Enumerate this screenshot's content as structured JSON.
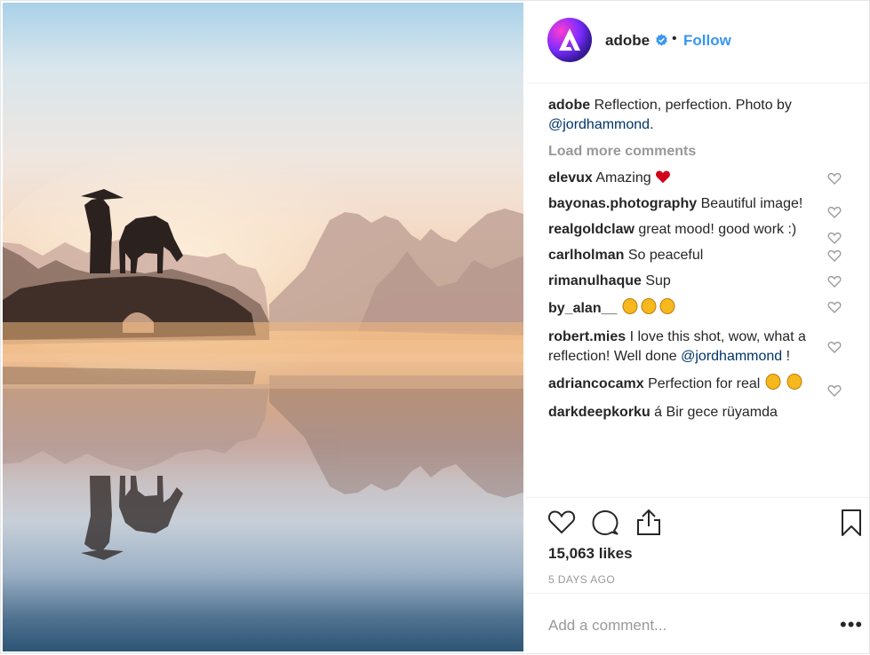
{
  "post": {
    "username": "adobe",
    "follow_label": "Follow",
    "separator": "•",
    "caption_user": "adobe",
    "caption_text": "Reflection, perfection. Photo by",
    "caption_tag": "@jordhammond",
    "caption_end": ".",
    "load_more": "Load more comments",
    "likes": "15,063 likes",
    "time_ago": "5 DAYS AGO",
    "add_comment_placeholder": "Add a comment...",
    "more_options": "•••"
  },
  "comments": [
    {
      "user": "elevux",
      "text": "Amazing",
      "emoji": "red-heart"
    },
    {
      "user": "bayonas.photography",
      "text": "Beautiful image!"
    },
    {
      "user": "realgoldclaw",
      "text": "great mood! good work :)"
    },
    {
      "user": "carlholman",
      "text": "So peaceful"
    },
    {
      "user": "rimanulhaque",
      "text": "Sup"
    },
    {
      "user": "by_alan__",
      "text": "",
      "emoji": "clapping-hands x3"
    },
    {
      "user": "robert.mies",
      "text": "I love this shot, wow, what a reflection! Well done",
      "tag": "@jordhammond",
      "end": " !"
    },
    {
      "user": "adriancocamx",
      "text": "Perfection for real",
      "emoji": "clapping-hands x2"
    },
    {
      "user": "darkdeepkorku",
      "text": "á Bir gece rüyamda"
    }
  ],
  "icons": [
    "verified-badge-icon",
    "like-icon",
    "comment-icon",
    "share-icon",
    "save-icon",
    "small-heart-icon"
  ],
  "colors": {
    "link": "#3897f0",
    "tag": "#003569",
    "muted": "#999999",
    "verified": "#3897f0"
  }
}
